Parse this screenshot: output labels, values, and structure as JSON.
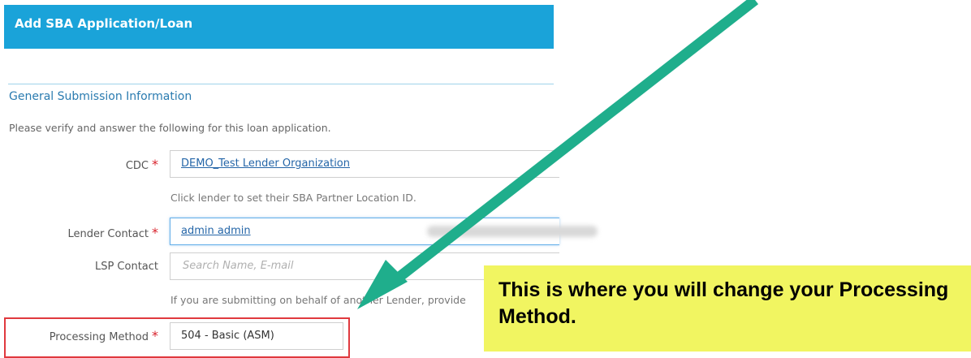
{
  "header": {
    "title": "Add SBA Application/Loan"
  },
  "section": {
    "title": "General Submission Information",
    "instructions": "Please verify and answer the following for this loan application."
  },
  "form": {
    "cdc": {
      "label": "CDC",
      "value": "DEMO_Test Lender Organization",
      "help": "Click lender to set their SBA Partner Location ID."
    },
    "lender_contact": {
      "label": "Lender Contact",
      "value": "admin admin"
    },
    "lsp_contact": {
      "label": "LSP Contact",
      "placeholder": "Search Name, E-mail",
      "help": "If you are submitting on behalf of another Lender, provide"
    },
    "processing_method": {
      "label": "Processing Method",
      "value": "504 - Basic (ASM)"
    },
    "required_marker": "*"
  },
  "callout": {
    "text": "This is where you will change your Processing Method."
  },
  "colors": {
    "header_bg": "#1aa3d9",
    "section_title": "#2a7bb0",
    "required": "#d9232d",
    "callout_bg": "#f1f561",
    "arrow": "#1fae8c",
    "highlight_box": "#e0393e"
  }
}
